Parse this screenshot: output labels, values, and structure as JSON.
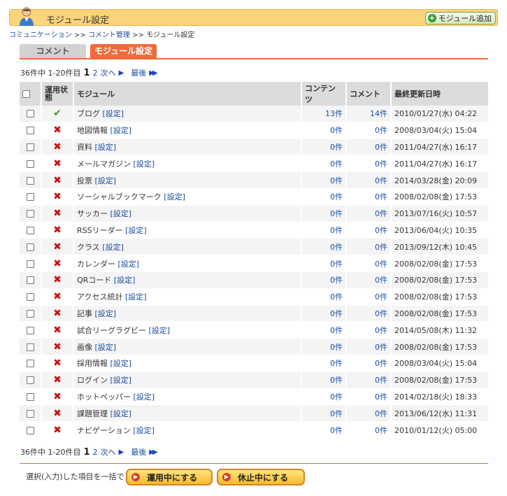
{
  "header": {
    "title": "モジュール設定",
    "add_button": "モジュール追加"
  },
  "breadcrumb": {
    "items": [
      "コミュニケーション",
      "コメント管理",
      "モジュール設定"
    ],
    "sep": " >> "
  },
  "tabs": [
    {
      "label": "コメント",
      "active": false
    },
    {
      "label": "モジュール設定",
      "active": true
    }
  ],
  "pager": {
    "summary": "36件中 1-20件目",
    "current": "1",
    "page2": "2",
    "next": "次へ",
    "last": "最後"
  },
  "table": {
    "headers": {
      "status": "運用状態",
      "module": "モジュール",
      "contents": "コンテンツ",
      "comments": "コメント",
      "updated": "最終更新日時"
    },
    "setting_link": "[設定]",
    "rows": [
      {
        "status": "on",
        "name": "ブログ",
        "contents": "13件",
        "comments": "14件",
        "updated": "2010/01/27(水) 04:22"
      },
      {
        "status": "off",
        "name": "地図情報",
        "contents": "0件",
        "comments": "0件",
        "updated": "2008/03/04(火) 15:04"
      },
      {
        "status": "off",
        "name": "資料",
        "contents": "0件",
        "comments": "0件",
        "updated": "2011/04/27(水) 16:17"
      },
      {
        "status": "off",
        "name": "メールマガジン",
        "contents": "0件",
        "comments": "0件",
        "updated": "2011/04/27(水) 16:17"
      },
      {
        "status": "off",
        "name": "投票",
        "contents": "0件",
        "comments": "0件",
        "updated": "2014/03/28(金) 20:09"
      },
      {
        "status": "off",
        "name": "ソーシャルブックマーク",
        "contents": "0件",
        "comments": "0件",
        "updated": "2008/02/08(金) 17:53"
      },
      {
        "status": "off",
        "name": "サッカー",
        "contents": "0件",
        "comments": "0件",
        "updated": "2013/07/16(火) 10:57"
      },
      {
        "status": "off",
        "name": "RSSリーダー",
        "contents": "0件",
        "comments": "0件",
        "updated": "2013/06/04(火) 10:35"
      },
      {
        "status": "off",
        "name": "クラス",
        "contents": "0件",
        "comments": "0件",
        "updated": "2013/09/12(木) 10:45"
      },
      {
        "status": "off",
        "name": "カレンダー",
        "contents": "0件",
        "comments": "0件",
        "updated": "2008/02/08(金) 17:53"
      },
      {
        "status": "off",
        "name": "QRコード",
        "contents": "0件",
        "comments": "0件",
        "updated": "2008/02/08(金) 17:53"
      },
      {
        "status": "off",
        "name": "アクセス統計",
        "contents": "0件",
        "comments": "0件",
        "updated": "2008/02/08(金) 17:53"
      },
      {
        "status": "off",
        "name": "記事",
        "contents": "0件",
        "comments": "0件",
        "updated": "2008/02/08(金) 17:53"
      },
      {
        "status": "off",
        "name": "試合リーグラグビー",
        "contents": "0件",
        "comments": "0件",
        "updated": "2014/05/08(木) 11:32"
      },
      {
        "status": "off",
        "name": "画像",
        "contents": "0件",
        "comments": "0件",
        "updated": "2008/02/08(金) 17:53"
      },
      {
        "status": "off",
        "name": "採用情報",
        "contents": "0件",
        "comments": "0件",
        "updated": "2008/03/04(火) 15:04"
      },
      {
        "status": "off",
        "name": "ログイン",
        "contents": "0件",
        "comments": "0件",
        "updated": "2008/02/08(金) 17:53"
      },
      {
        "status": "off",
        "name": "ホットペッパー",
        "contents": "0件",
        "comments": "0件",
        "updated": "2014/02/18(火) 18:33"
      },
      {
        "status": "off",
        "name": "課題管理",
        "contents": "0件",
        "comments": "0件",
        "updated": "2013/06/12(水) 11:31"
      },
      {
        "status": "off",
        "name": "ナビゲーション",
        "contents": "0件",
        "comments": "0件",
        "updated": "2010/01/12(火) 05:00"
      }
    ]
  },
  "bulk": {
    "label": "選択(入力)した項目を一括で",
    "activate": "運用中にする",
    "suspend": "休止中にする"
  },
  "icons": {
    "status_on": "check-icon",
    "status_off": "cross-icon"
  },
  "colors": {
    "accent": "#f06a3a",
    "header_bg": "#fbd47a",
    "link": "#1a4ea0",
    "ok": "#3a9a1f",
    "ng": "#d01010"
  }
}
